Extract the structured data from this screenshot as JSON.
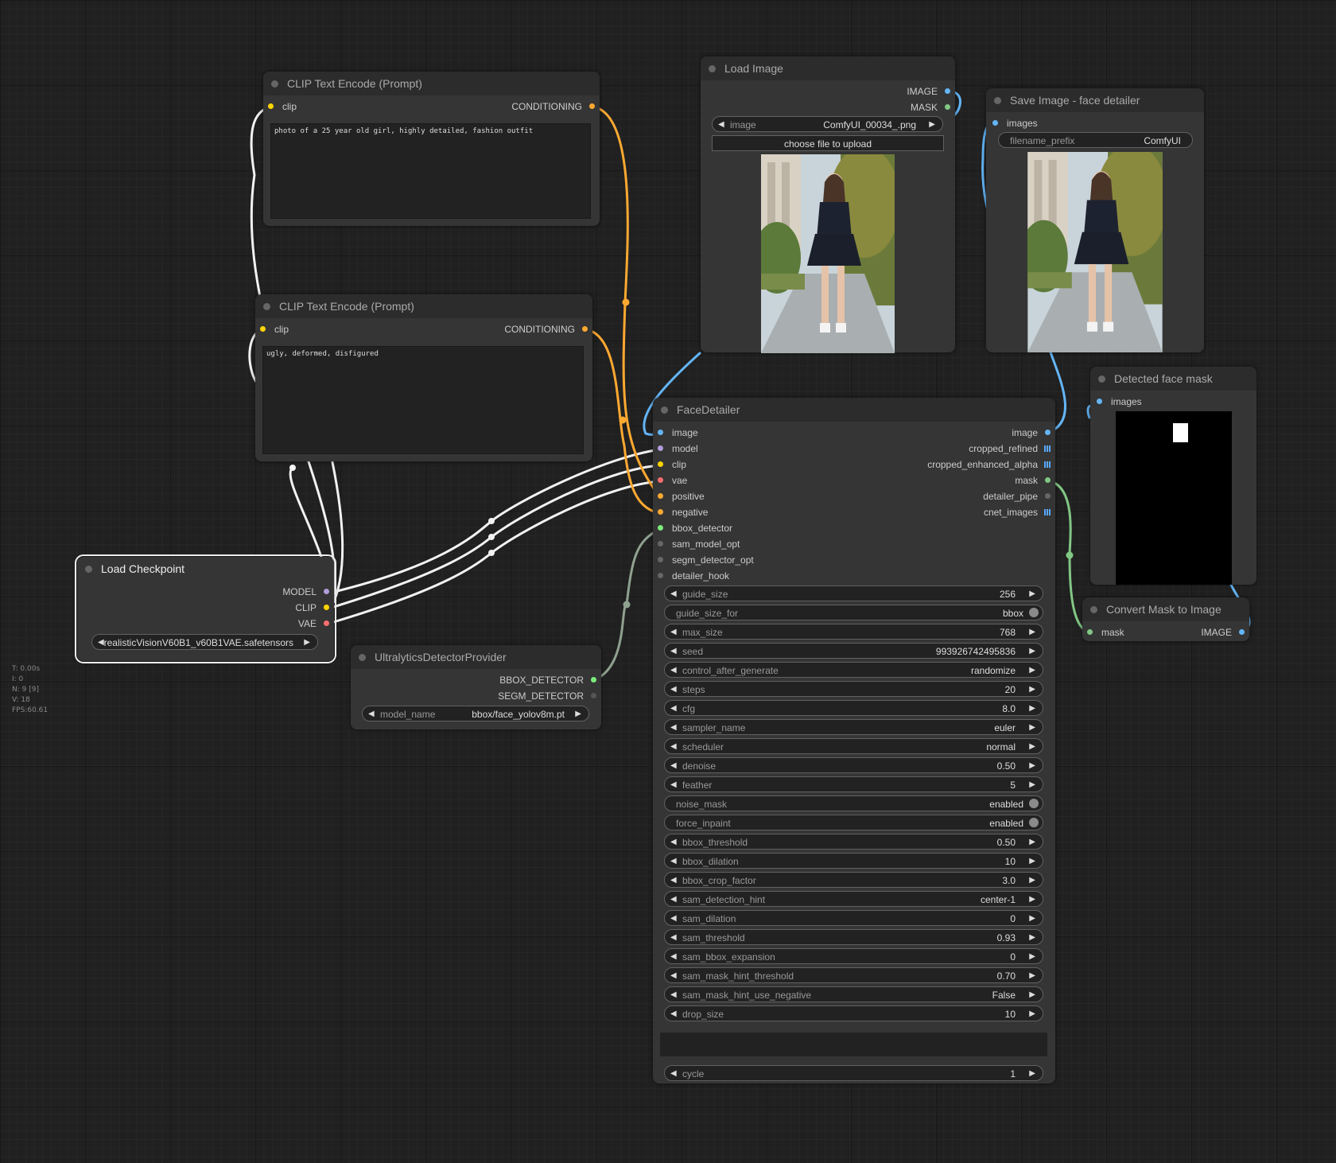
{
  "stats": {
    "t": "T: 0.00s",
    "i": "I: 0",
    "n": "N: 9 [9]",
    "v": "V: 18",
    "fps": "FPS:60.61"
  },
  "colors": {
    "clip": "#ffd500",
    "conditioning": "#ffa931",
    "image": "#64b5f6",
    "mask": "#81c784",
    "model": "#b39ddb",
    "vae": "#ff6e6e",
    "detector": "#7cec7c",
    "generic": "#888888"
  },
  "clip_pos": {
    "title": "CLIP Text Encode (Prompt)",
    "in_clip": "clip",
    "out_conditioning": "CONDITIONING",
    "text": "photo of a 25 year old girl, highly detailed, fashion outfit"
  },
  "clip_neg": {
    "title": "CLIP Text Encode (Prompt)",
    "in_clip": "clip",
    "out_conditioning": "CONDITIONING",
    "text": "ugly, deformed, disfigured"
  },
  "load_checkpoint": {
    "title": "Load Checkpoint",
    "out_model": "MODEL",
    "out_clip": "CLIP",
    "out_vae": "VAE",
    "ckpt_value": "realisticVisionV60B1_v60B1VAE.safetensors"
  },
  "ultralytics": {
    "title": "UltralyticsDetectorProvider",
    "out_bbox": "BBOX_DETECTOR",
    "out_segm": "SEGM_DETECTOR",
    "model_label": "model_name",
    "model_value": "bbox/face_yolov8m.pt"
  },
  "load_image": {
    "title": "Load Image",
    "out_image": "IMAGE",
    "out_mask": "MASK",
    "image_label": "image",
    "image_value": "ComfyUI_00034_.png",
    "upload_button": "choose file to upload"
  },
  "save_image": {
    "title": "Save Image - face detailer",
    "in_images": "images",
    "prefix_label": "filename_prefix",
    "prefix_value": "ComfyUI"
  },
  "face_mask": {
    "title": "Detected face mask",
    "in_images": "images"
  },
  "convert_mask": {
    "title": "Convert Mask to Image",
    "in_mask": "mask",
    "out_image": "IMAGE"
  },
  "face_detailer": {
    "title": "FaceDetailer",
    "inputs": [
      "image",
      "model",
      "clip",
      "vae",
      "positive",
      "negative",
      "bbox_detector",
      "sam_model_opt",
      "segm_detector_opt",
      "detailer_hook"
    ],
    "outputs": [
      "image",
      "cropped_refined",
      "cropped_enhanced_alpha",
      "mask",
      "detailer_pipe",
      "cnet_images"
    ],
    "widgets": [
      {
        "label": "guide_size",
        "value": "256",
        "kind": "number"
      },
      {
        "label": "guide_size_for",
        "value": "bbox",
        "kind": "toggle"
      },
      {
        "label": "max_size",
        "value": "768",
        "kind": "number"
      },
      {
        "label": "seed",
        "value": "993926742495836",
        "kind": "number"
      },
      {
        "label": "control_after_generate",
        "value": "randomize",
        "kind": "number"
      },
      {
        "label": "steps",
        "value": "20",
        "kind": "number"
      },
      {
        "label": "cfg",
        "value": "8.0",
        "kind": "number"
      },
      {
        "label": "sampler_name",
        "value": "euler",
        "kind": "number"
      },
      {
        "label": "scheduler",
        "value": "normal",
        "kind": "number"
      },
      {
        "label": "denoise",
        "value": "0.50",
        "kind": "number"
      },
      {
        "label": "feather",
        "value": "5",
        "kind": "number"
      },
      {
        "label": "noise_mask",
        "value": "enabled",
        "kind": "toggle"
      },
      {
        "label": "force_inpaint",
        "value": "enabled",
        "kind": "toggle"
      },
      {
        "label": "bbox_threshold",
        "value": "0.50",
        "kind": "number"
      },
      {
        "label": "bbox_dilation",
        "value": "10",
        "kind": "number"
      },
      {
        "label": "bbox_crop_factor",
        "value": "3.0",
        "kind": "number"
      },
      {
        "label": "sam_detection_hint",
        "value": "center-1",
        "kind": "number"
      },
      {
        "label": "sam_dilation",
        "value": "0",
        "kind": "number"
      },
      {
        "label": "sam_threshold",
        "value": "0.93",
        "kind": "number"
      },
      {
        "label": "sam_bbox_expansion",
        "value": "0",
        "kind": "number"
      },
      {
        "label": "sam_mask_hint_threshold",
        "value": "0.70",
        "kind": "number"
      },
      {
        "label": "sam_mask_hint_use_negative",
        "value": "False",
        "kind": "number"
      },
      {
        "label": "drop_size",
        "value": "10",
        "kind": "number"
      }
    ],
    "cycle_label": "cycle",
    "cycle_value": "1"
  }
}
